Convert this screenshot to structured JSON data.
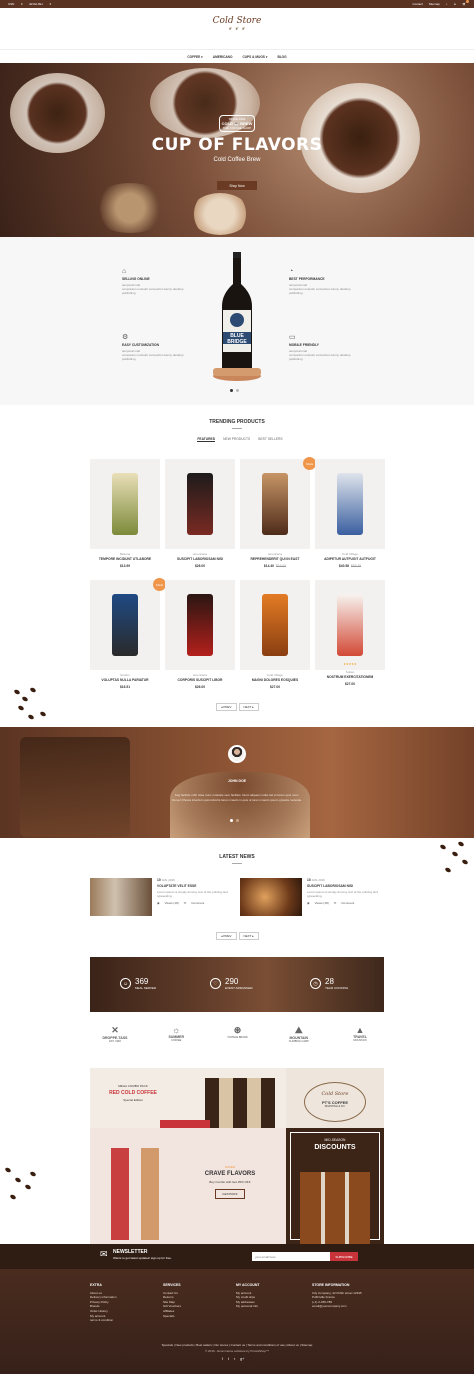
{
  "topbar": {
    "currency": "USD",
    "language": "ENGLISH",
    "contact": "Contact",
    "sitemap": "Sitemap"
  },
  "header": {
    "logo": "Cold Store",
    "logo_sub": "❦ ❦ ❦"
  },
  "nav": [
    {
      "label": "COFFEE",
      "has_menu": true
    },
    {
      "label": "AMERICANO",
      "has_menu": false
    },
    {
      "label": "CUPS & MUGS",
      "has_menu": true
    },
    {
      "label": "BLOG",
      "has_menu": false
    }
  ],
  "hero": {
    "badge_top": "SINCE 1994",
    "badge_mid": "COLD ☕ BREW",
    "badge_bot": "THE COFFEE SHOP",
    "title": "CUP OF FLAVORS",
    "subtitle": "Cold Coffee Brew",
    "button": "Shop Now"
  },
  "features": [
    {
      "title": "SELLING ONLINE",
      "desc": "temporal mail\ncompanion network connection Hemy desktop publishing",
      "icon": "tag-icon"
    },
    {
      "title": "EASY CUSTOMIZATION",
      "desc": "temporal mail\ncompanion network connection Hemy desktop publishing",
      "icon": "gear-icon"
    },
    {
      "title": "BEST PERFORMANCE",
      "desc": "temporal mail\ncompanion network connection Hemy desktop publishing",
      "icon": "gauge-icon"
    },
    {
      "title": "MOBILE FRIENDLY",
      "desc": "temporal mail\ncompanion network connection Hemy desktop publishing",
      "icon": "monitor-icon"
    }
  ],
  "bottle_label": "BLUE\nBRIDGE",
  "trending": {
    "title": "TRENDING PRODUCTS",
    "tabs": [
      "FEATURED",
      "NEW PRODUCTS",
      "BEST SELLERS"
    ]
  },
  "products": [
    {
      "cat": "Beltona",
      "name": "TEMPORE INCIDUNT UTLABORE",
      "price": "$13.99",
      "old": "",
      "sale": "",
      "stars": ""
    },
    {
      "cat": "americana",
      "name": "SUSCIPIT LABORIOSAM NISI",
      "price": "$26.00",
      "old": "",
      "sale": "",
      "stars": ""
    },
    {
      "cat": "americana",
      "name": "REPREHENDERIT QUI IN EAST",
      "price": "$14.40",
      "old": "$16.00",
      "sale": "SALE",
      "stars": ""
    },
    {
      "cat": "Cold Village",
      "name": "ADIPETUR AUTFUGIT AUTFUGIT",
      "price": "$40.58",
      "old": "$53.38",
      "sale": "",
      "stars": ""
    },
    {
      "cat": "Sandro",
      "name": "VOLUPTAS NULLA PARIATUR",
      "price": "$16.51",
      "old": "",
      "sale": "SALE",
      "stars": ""
    },
    {
      "cat": "americana",
      "name": "CORPORIS SUSCIPIT LIBOR",
      "price": "$26.00",
      "old": "",
      "sale": "",
      "stars": ""
    },
    {
      "cat": "Cold Village",
      "name": "MAGNI DOLORES EOSQUIES",
      "price": "$27.00",
      "old": "",
      "sale": "",
      "stars": ""
    },
    {
      "cat": "Sultan",
      "name": "NOSTRUM EXERCITATIONEM",
      "price": "$27.00",
      "old": "",
      "sale": "",
      "stars": "★★★★★"
    }
  ],
  "pager": {
    "prev": "◂ PREV",
    "next": "NEXT ▸"
  },
  "testimonial": {
    "name": "JOHN DOE",
    "quote": "Sug facilisis nibh vitae nunc molestie sem facilisis. Nunc aliquam nulla nisl et lorem quis nunc. Donec Dhosia interdum quis lobortis lorem mauris in quis ut lorem mauris ipsum gravida molestie."
  },
  "news": {
    "title": "LATEST NEWS",
    "items": [
      {
        "date": "10",
        "month": "JAN, 2016",
        "title": "VOLUPTATE VELIT ESSE",
        "desc": "Lorem ipsum is simply dummy text of the printing and typesetting.",
        "views": "Views (18)",
        "comment": "Comment"
      },
      {
        "date": "10",
        "month": "JAN, 2016",
        "title": "SUSCIPIT LABORIOSAM NISI",
        "desc": "Lorem ipsum is simply dummy text of the printing and typesetting.",
        "views": "Views (18)",
        "comment": "Comment"
      }
    ]
  },
  "stats": [
    {
      "num": "369",
      "label": "MEAL SERVED",
      "icon": "smile-icon"
    },
    {
      "num": "290",
      "label": "EVENT ARRANGED",
      "icon": "heart-icon"
    },
    {
      "num": "28",
      "label": "YEAR COOKING",
      "icon": "clock-icon"
    }
  ],
  "brands": [
    {
      "name": "DROPPE-TASS",
      "sub": "EST. 1983"
    },
    {
      "name": "SUMMER",
      "sub": "COFFEE"
    },
    {
      "name": "",
      "sub": "VINTAGE BRAND"
    },
    {
      "name": "MOUNTAIN",
      "sub": "CLIMBING CAMP"
    },
    {
      "name": "TRAVEL",
      "sub": "MOUNTAIN"
    }
  ],
  "promo": {
    "a_top": "MEGA COMBO PACK",
    "a_title": "RED COLD COFFEE",
    "a_sub": "Special Edition",
    "b_logo": "Cold Store",
    "b_sub": "PT'S COFFEE",
    "b_sub2": "ROASTING & CO.",
    "c_top": "OFFER",
    "c_title": "CRAVE FLAVORS",
    "c_sub": "Buy Combo with Get 25% OFF",
    "c_btn": "GET25OFF",
    "d_top": "MID-SEASON",
    "d_title": "DISCOUNTS"
  },
  "newsletter": {
    "title": "NEWSLETTER",
    "desc": "Wants to get latest updates! sign up for free.",
    "placeholder": "your email here",
    "button": "SUBSCRIBE"
  },
  "footer": {
    "cols": [
      {
        "h": "EXTRA",
        "items": [
          "About us",
          "Delivery information",
          "Privacy Policy",
          "Brands",
          "Order History",
          "My account",
          "terms & condition"
        ]
      },
      {
        "h": "SERVICES",
        "items": [
          "Contact Us",
          "Returns",
          "Site Map",
          "Gift Vouchers",
          "Affiliates",
          "Specials"
        ]
      },
      {
        "h": "MY ACCOUNT",
        "items": [
          "My account",
          "My credit slips",
          "My addresses",
          "My personal info"
        ]
      },
      {
        "h": "STORE INFORMATION",
        "items": [
          "City Company, 42 Puffin street 12345",
          "Puffinville France",
          "(+1) 2-456-789",
          "email@yourcompany.com"
        ]
      }
    ],
    "links": "Specials | New products | Best sellers | Our stores | Contact us | Terms and conditions of use | About us | Sitemap",
    "copy": "© 2016 - Ecommerce software by PrestaShop™",
    "social": [
      "f",
      "t",
      "r",
      "g+"
    ]
  },
  "colors": {
    "brand": "#6a3b22",
    "sale": "#f0964b",
    "newsletter_btn": "#c8343a"
  }
}
